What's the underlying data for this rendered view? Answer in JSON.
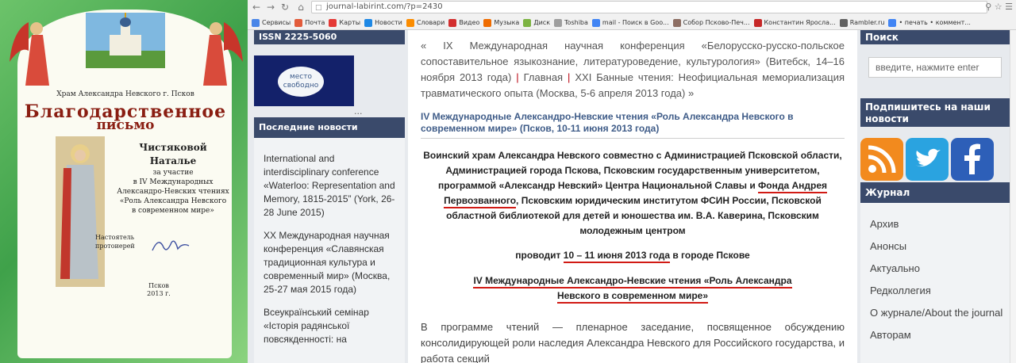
{
  "certificate": {
    "temple": "Храм Александра Невского г. Псков",
    "title_line1": "Благодарственное",
    "title_line2": "письмо",
    "recipient_line1": "Чистяковой",
    "recipient_line2": "Наталье",
    "text_line1": "за участие",
    "text_line2": "в IV Международных",
    "text_line3": "Александро-Невских чтениях",
    "text_line4": "«Роль Александра Невского",
    "text_line5": "в современном мире»",
    "sign_line1": "Настоятель",
    "sign_line2": "протоиерей",
    "city": "Псков",
    "year": "2013 г."
  },
  "browser": {
    "url": "journal-labirint.com/?p=2430",
    "bookmarks": [
      {
        "label": "Сервисы",
        "color": "#4a86e8"
      },
      {
        "label": "Почта",
        "color": "#e25b3a"
      },
      {
        "label": "Карты",
        "color": "#e53935"
      },
      {
        "label": "Новости",
        "color": "#1e88e5"
      },
      {
        "label": "Словари",
        "color": "#fb8c00"
      },
      {
        "label": "Видео",
        "color": "#d32f2f"
      },
      {
        "label": "Музыка",
        "color": "#ef6c00"
      },
      {
        "label": "Диск",
        "color": "#7cb342"
      },
      {
        "label": "Toshiba",
        "color": "#9e9e9e"
      },
      {
        "label": "mail - Поиск в Goo...",
        "color": "#4285f4"
      },
      {
        "label": "Собор Псково-Печ...",
        "color": "#8d6e63"
      },
      {
        "label": "Константин Яросла...",
        "color": "#c62828"
      },
      {
        "label": "Rambler.ru",
        "color": "#616161"
      },
      {
        "label": "• печать • коммент...",
        "color": "#4285f4"
      }
    ]
  },
  "left": {
    "issn": "ISSN 2225-5060",
    "ad_text": "место свободно",
    "dots": "...",
    "news_heading": "Последние новости",
    "news": [
      "International and interdisciplinary conference «Waterloo: Representation and Memory, 1815-2015” (York, 26-28 June 2015)",
      "XX Международная научная конференция «Славянская традиционная культура и современный мир» (Москва, 25-27 мая 2015 года)",
      "Всеукраїнський семінар «Історія радянської повсякденності: на"
    ]
  },
  "main": {
    "nav_prev": "« IX Международная научная конференция «Белорусско-русско-польское сопоставительное языкознание, литературоведение, культурология» (Витебск, 14–16 ноября 2013 года)",
    "nav_sep": "|",
    "nav_home": "Главная",
    "nav_next": "XXI Банные чтения: Неофициальная мемориализация травматического опыта (Москва, 5-6 апреля 2013 года) »",
    "title": "IV Международные Александро-Невские чтения «Роль Александра Невского в современном мире» (Псков, 10-11 июня 2013 года)",
    "intro_part1": "Воинский храм Александра Невского совместно с Администрацией Псковской области, Администрацией города Пскова, Псковским государственным университетом, программой «Александр Невский» Центра Национальной Славы и ",
    "intro_highlight": "Фонда Андрея Первозванного",
    "intro_part2": ", Псковским юридическим институтом ФСИН России, Псковской областной библиотекой для детей и юношества им. В.А. Каверина, Псковским молодежным центром",
    "hold_prefix": "проводит ",
    "hold_dates": "10 – 11 июня 2013 года",
    "hold_suffix": " в городе Пскове",
    "conf_line1": "IV Международные Александро-Невские чтения  «Роль Александра",
    "conf_line2": "Невского в современном мире»",
    "body": "В программе чтений — пленарное заседание, посвященное обсуждению консолидирующей роли наследия Александра Невского для Российского государства, и работа секций"
  },
  "right": {
    "search_heading": "Поиск",
    "search_placeholder": "введите, нажмите enter",
    "subscribe_heading": "Подпишитесь на наши новости",
    "journal_heading": "Журнал",
    "journal_items": [
      "Архив",
      "Анонсы",
      "Актуально",
      "Редколлегия",
      "О журнале/About the journal",
      "Авторам"
    ]
  }
}
